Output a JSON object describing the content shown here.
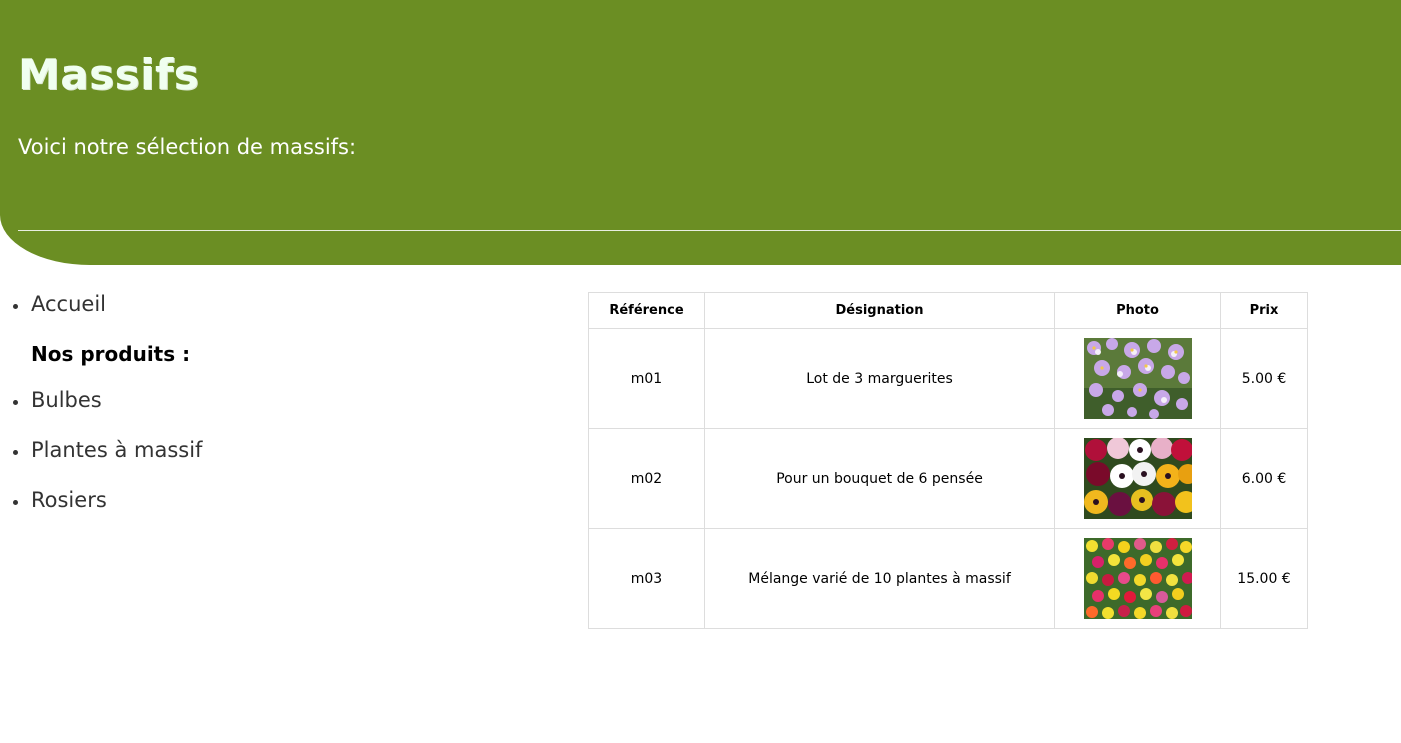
{
  "header": {
    "title": "Massifs",
    "subtitle": "Voici notre sélection de massifs:",
    "background_color": "#6b8e23"
  },
  "nav": {
    "home": "Accueil",
    "products_heading": "Nos produits :",
    "items": [
      "Bulbes",
      "Plantes à massif",
      "Rosiers"
    ]
  },
  "table": {
    "headers": [
      "Référence",
      "Désignation",
      "Photo",
      "Prix"
    ],
    "rows": [
      {
        "reference": "m01",
        "designation": "Lot de 3 marguerites",
        "photo": "purple-daisies-photo",
        "prix": "5.00 €"
      },
      {
        "reference": "m02",
        "designation": "Pour un bouquet de 6 pensée",
        "photo": "pansies-photo",
        "prix": "6.00 €"
      },
      {
        "reference": "m03",
        "designation": "Mélange varié de 10 plantes à massif",
        "photo": "mixed-flowerbed-photo",
        "prix": "15.00 €"
      }
    ]
  }
}
